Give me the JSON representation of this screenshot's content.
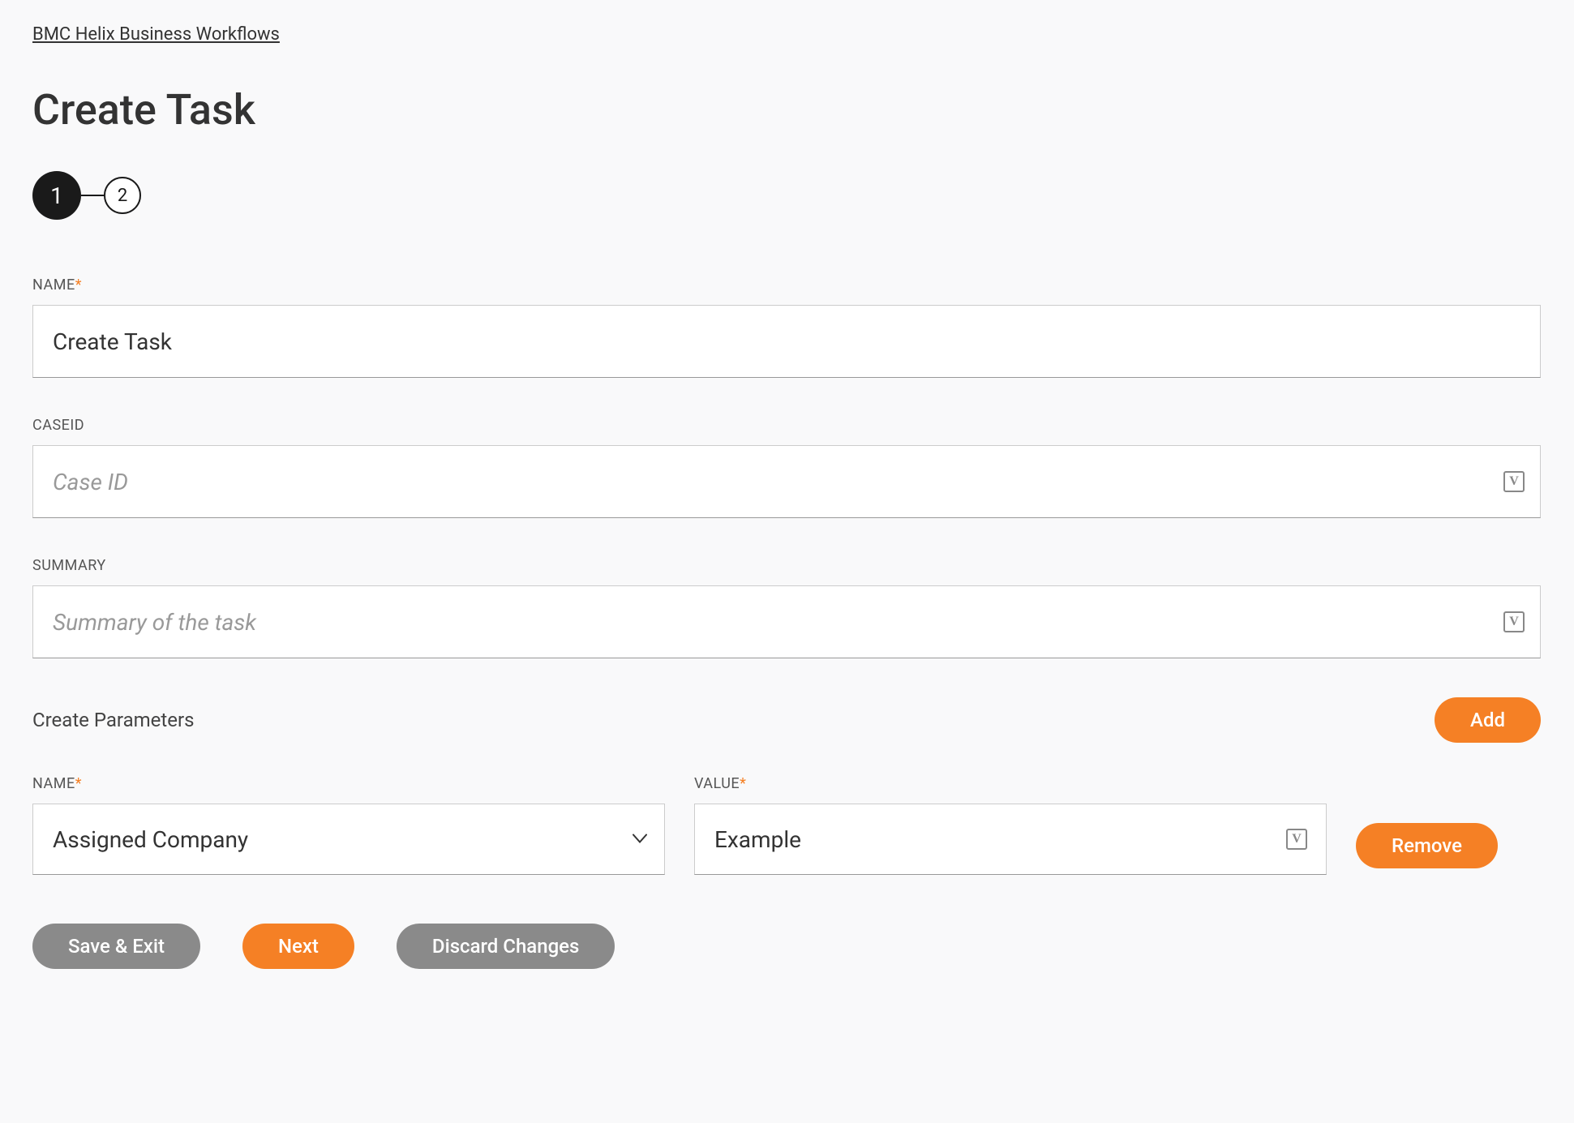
{
  "breadcrumb": "BMC Helix Business Workflows",
  "page_title": "Create Task",
  "stepper": {
    "step1": "1",
    "step2": "2"
  },
  "fields": {
    "name": {
      "label": "NAME",
      "value": "Create Task"
    },
    "caseid": {
      "label": "CASEID",
      "placeholder": "Case ID",
      "value": ""
    },
    "summary": {
      "label": "SUMMARY",
      "placeholder": "Summary of the task",
      "value": ""
    }
  },
  "parameters": {
    "section_title": "Create Parameters",
    "add_label": "Add",
    "remove_label": "Remove",
    "row": {
      "name_label": "NAME",
      "name_value": "Assigned Company",
      "value_label": "VALUE",
      "value_value": "Example"
    }
  },
  "footer": {
    "save_exit": "Save & Exit",
    "next": "Next",
    "discard": "Discard Changes"
  }
}
